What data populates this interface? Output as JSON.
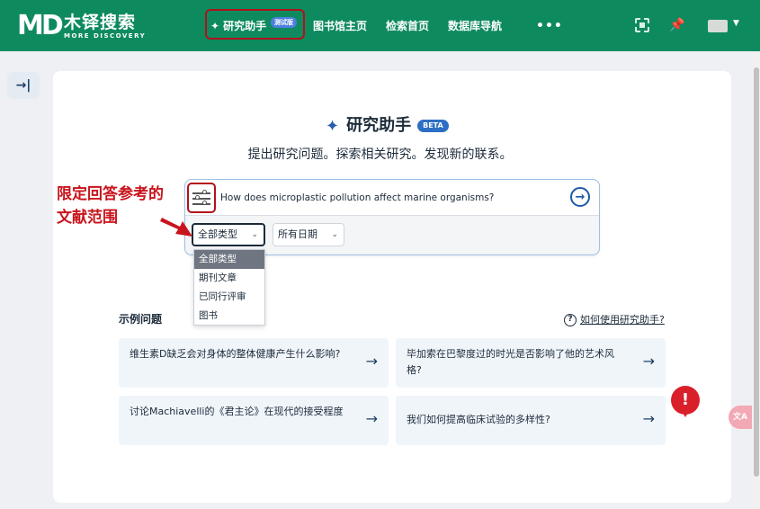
{
  "brand": {
    "name_cn": "木铎搜索",
    "name_en": "MORE DISCOVERY",
    "logo_mark": "MD"
  },
  "nav": {
    "assistant_label": "研究助手",
    "assistant_badge": "测试版",
    "items": [
      "图书馆主页",
      "检索首页",
      "数据库导航",
      "•••"
    ]
  },
  "rail": {
    "expand_icon": "→|"
  },
  "page": {
    "title": "研究助手",
    "beta": "BETA",
    "subtitle": "提出研究问题。探索相关研究。发现新的联系。"
  },
  "search": {
    "query": "How does microplastic pollution affect marine organisms?",
    "go_symbol": "→"
  },
  "filters": {
    "type_selected": "全部类型",
    "date_selected": "所有日期",
    "type_options": [
      "全部类型",
      "期刊文章",
      "已同行评审",
      "图书"
    ]
  },
  "annotation": {
    "text": "限定回答参考的文献范围"
  },
  "examples": {
    "heading": "示例问题",
    "howto": "如何使用研究助手?",
    "items": [
      "维生素D缺乏会对身体的整体健康产生什么影响?",
      "毕加索在巴黎度过的时光是否影响了他的艺术风格?",
      "讨论Machiavelli的《君主论》在现代的接受程度",
      "我们如何提高临床试验的多样性?"
    ]
  },
  "alert": {
    "symbol": "!"
  },
  "translate": {
    "label": "文A"
  },
  "colors": {
    "brand": "#0e8a5f",
    "annotation": "#c8141c",
    "accent": "#1e5aa8"
  }
}
